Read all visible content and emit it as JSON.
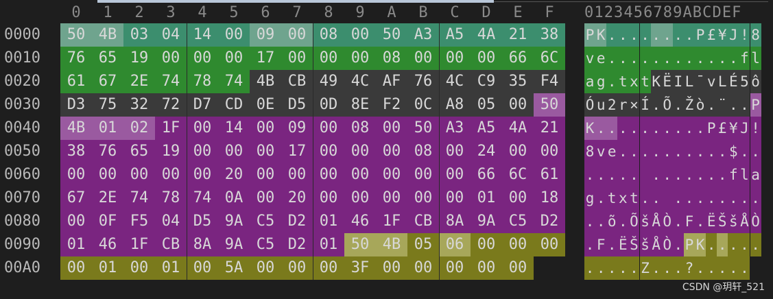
{
  "colors": {
    "dark": "#3a3a3a",
    "teal": "#3c8e6e",
    "green": "#2f8a2f",
    "purple": "#7a2580",
    "purple_light": "#9a5aa0",
    "olive": "#7a7a1c",
    "olive_light": "#a7a75a",
    "teal_light": "#6fa48e"
  },
  "header": {
    "hex_columns": [
      "0",
      "1",
      "2",
      "3",
      "4",
      "5",
      "6",
      "7",
      "8",
      "9",
      "A",
      "B",
      "C",
      "D",
      "E",
      "F"
    ],
    "ascii_columns": "0123456789ABCDEF"
  },
  "rows": [
    {
      "offset": "0000",
      "hex": [
        "50",
        "4B",
        "03",
        "04",
        "14",
        "00",
        "09",
        "00",
        "08",
        "00",
        "50",
        "A3",
        "A5",
        "4A",
        "21",
        "38"
      ],
      "ascii": [
        "P",
        "K",
        ".",
        ".",
        ".",
        ".",
        ".",
        ".",
        ".",
        ".",
        "P",
        "£",
        "¥",
        "J",
        "!",
        "8"
      ],
      "style": [
        "tl",
        "tl",
        "t",
        "t",
        "t",
        "t",
        "tl",
        "tl",
        "t",
        "t",
        "t",
        "t",
        "t",
        "t",
        "t",
        "t"
      ]
    },
    {
      "offset": "0010",
      "hex": [
        "76",
        "65",
        "19",
        "00",
        "00",
        "00",
        "17",
        "00",
        "00",
        "00",
        "08",
        "00",
        "00",
        "00",
        "66",
        "6C"
      ],
      "ascii": [
        "v",
        "e",
        ".",
        ".",
        ".",
        ".",
        ".",
        ".",
        ".",
        ".",
        ".",
        ".",
        ".",
        ".",
        "f",
        "l"
      ],
      "style": [
        "g",
        "g",
        "g",
        "g",
        "g",
        "g",
        "g",
        "g",
        "g",
        "g",
        "g",
        "g",
        "g",
        "g",
        "g",
        "g"
      ]
    },
    {
      "offset": "0020",
      "hex": [
        "61",
        "67",
        "2E",
        "74",
        "78",
        "74",
        "4B",
        "CB",
        "49",
        "4C",
        "AF",
        "76",
        "4C",
        "C9",
        "35",
        "F4"
      ],
      "ascii": [
        "a",
        "g",
        ".",
        "t",
        "x",
        "t",
        "K",
        "Ë",
        "I",
        "L",
        "¯",
        "v",
        "L",
        "É",
        "5",
        "ô"
      ],
      "style": [
        "g",
        "g",
        "g",
        "g",
        "g",
        "g",
        "d",
        "d",
        "d",
        "d",
        "d",
        "d",
        "d",
        "d",
        "d",
        "d"
      ]
    },
    {
      "offset": "0030",
      "hex": [
        "D3",
        "75",
        "32",
        "72",
        "D7",
        "CD",
        "0E",
        "D5",
        "0D",
        "8E",
        "F2",
        "0C",
        "A8",
        "05",
        "00",
        "50"
      ],
      "ascii": [
        "Ó",
        "u",
        "2",
        "r",
        "×",
        "Í",
        ".",
        "Õ",
        ".",
        "Ž",
        "ò",
        ".",
        "¨",
        ".",
        ".",
        "P"
      ],
      "style": [
        "d",
        "d",
        "d",
        "d",
        "d",
        "d",
        "d",
        "d",
        "d",
        "d",
        "d",
        "d",
        "d",
        "d",
        "d",
        "pl"
      ]
    },
    {
      "offset": "0040",
      "hex": [
        "4B",
        "01",
        "02",
        "1F",
        "00",
        "14",
        "00",
        "09",
        "00",
        "08",
        "00",
        "50",
        "A3",
        "A5",
        "4A",
        "21"
      ],
      "ascii": [
        "K",
        ".",
        ".",
        ".",
        ".",
        ".",
        ".",
        ".",
        ".",
        ".",
        ".",
        "P",
        "£",
        "¥",
        "J",
        "!"
      ],
      "style": [
        "pl",
        "pl",
        "pl",
        "p",
        "p",
        "p",
        "p",
        "p",
        "p",
        "p",
        "p",
        "p",
        "p",
        "p",
        "p",
        "p"
      ]
    },
    {
      "offset": "0050",
      "hex": [
        "38",
        "76",
        "65",
        "19",
        "00",
        "00",
        "00",
        "17",
        "00",
        "00",
        "00",
        "08",
        "00",
        "24",
        "00",
        "00"
      ],
      "ascii": [
        "8",
        "v",
        "e",
        ".",
        ".",
        ".",
        ".",
        ".",
        ".",
        ".",
        ".",
        ".",
        ".",
        "$",
        ".",
        "."
      ],
      "style": [
        "p",
        "p",
        "p",
        "p",
        "p",
        "p",
        "p",
        "p",
        "p",
        "p",
        "p",
        "p",
        "p",
        "p",
        "p",
        "p"
      ]
    },
    {
      "offset": "0060",
      "hex": [
        "00",
        "00",
        "00",
        "00",
        "00",
        "20",
        "00",
        "00",
        "00",
        "00",
        "00",
        "00",
        "00",
        "66",
        "6C",
        "61"
      ],
      "ascii": [
        ".",
        ".",
        ".",
        ".",
        ".",
        " ",
        ".",
        ".",
        ".",
        ".",
        ".",
        ".",
        ".",
        "f",
        "l",
        "a"
      ],
      "style": [
        "p",
        "p",
        "p",
        "p",
        "p",
        "p",
        "p",
        "p",
        "p",
        "p",
        "p",
        "p",
        "p",
        "p",
        "p",
        "p"
      ]
    },
    {
      "offset": "0070",
      "hex": [
        "67",
        "2E",
        "74",
        "78",
        "74",
        "0A",
        "00",
        "20",
        "00",
        "00",
        "00",
        "00",
        "00",
        "01",
        "00",
        "18"
      ],
      "ascii": [
        "g",
        ".",
        "t",
        "x",
        "t",
        ".",
        ".",
        " ",
        ".",
        ".",
        ".",
        ".",
        ".",
        ".",
        ".",
        "."
      ],
      "style": [
        "p",
        "p",
        "p",
        "p",
        "p",
        "p",
        "p",
        "p",
        "p",
        "p",
        "p",
        "p",
        "p",
        "p",
        "p",
        "p"
      ]
    },
    {
      "offset": "0080",
      "hex": [
        "00",
        "0F",
        "F5",
        "04",
        "D5",
        "9A",
        "C5",
        "D2",
        "01",
        "46",
        "1F",
        "CB",
        "8A",
        "9A",
        "C5",
        "D2"
      ],
      "ascii": [
        ".",
        ".",
        "õ",
        ".",
        "Õ",
        "š",
        "Å",
        "Ò",
        ".",
        "F",
        ".",
        "Ë",
        "Š",
        "š",
        "Å",
        "Ò"
      ],
      "style": [
        "p",
        "p",
        "p",
        "p",
        "p",
        "p",
        "p",
        "p",
        "p",
        "p",
        "p",
        "p",
        "p",
        "p",
        "p",
        "p"
      ]
    },
    {
      "offset": "0090",
      "hex": [
        "01",
        "46",
        "1F",
        "CB",
        "8A",
        "9A",
        "C5",
        "D2",
        "01",
        "50",
        "4B",
        "05",
        "06",
        "00",
        "00",
        "00"
      ],
      "ascii": [
        ".",
        "F",
        ".",
        "Ë",
        "Š",
        "š",
        "Å",
        "Ò",
        ".",
        "P",
        "K",
        ".",
        ".",
        ".",
        ".",
        "."
      ],
      "style": [
        "p",
        "p",
        "p",
        "p",
        "p",
        "p",
        "p",
        "p",
        "p",
        "ol",
        "ol",
        "o",
        "ol",
        "o",
        "o",
        "o"
      ]
    },
    {
      "offset": "00A0",
      "hex": [
        "00",
        "01",
        "00",
        "01",
        "00",
        "5A",
        "00",
        "00",
        "00",
        "3F",
        "00",
        "00",
        "00",
        "00",
        "00"
      ],
      "ascii": [
        ".",
        ".",
        ".",
        ".",
        ".",
        "Z",
        ".",
        ".",
        ".",
        "?",
        ".",
        ".",
        ".",
        ".",
        "."
      ],
      "style": [
        "o",
        "o",
        "o",
        "o",
        "o",
        "o",
        "o",
        "o",
        "o",
        "o",
        "o",
        "o",
        "o",
        "o",
        "o"
      ]
    }
  ],
  "watermark": "CSDN @玥轩_521"
}
